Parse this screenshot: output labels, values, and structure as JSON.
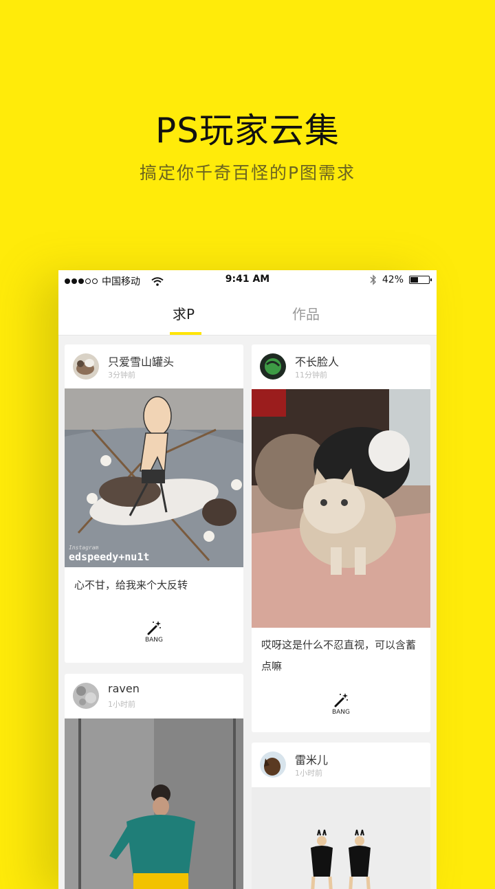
{
  "hero": {
    "title": "PS玩家云集",
    "subtitle": "搞定你千奇百怪的P图需求"
  },
  "status_bar": {
    "carrier": "中国移动",
    "time": "9:41 AM",
    "battery": "42%",
    "battery_level": 0.42,
    "icons": [
      "signal-dots-icon",
      "wifi-icon",
      "bluetooth-icon",
      "battery-icon"
    ]
  },
  "tabs": [
    {
      "label": "求P",
      "active": true
    },
    {
      "label": "作品",
      "active": false
    }
  ],
  "colors": {
    "brand_yellow": "#FFEB0A",
    "tab_indicator": "#FFE400"
  },
  "feed": {
    "left": [
      {
        "user": "只爱雪山罐头",
        "time": "3分钟前",
        "photo_watermark": "edspeedy+nu1t",
        "photo_watermark_small": "Instagram",
        "caption": "心不甘，给我来个大反转",
        "action": "BANG"
      },
      {
        "user": "raven",
        "time": "1小时前"
      }
    ],
    "right": [
      {
        "user": "不长脸人",
        "time": "11分钟前",
        "caption": "哎呀这是什么不忍直视，可以含蓄点嘛",
        "action": "BANG"
      },
      {
        "user": "雷米儿",
        "time": "1小时前"
      }
    ]
  }
}
